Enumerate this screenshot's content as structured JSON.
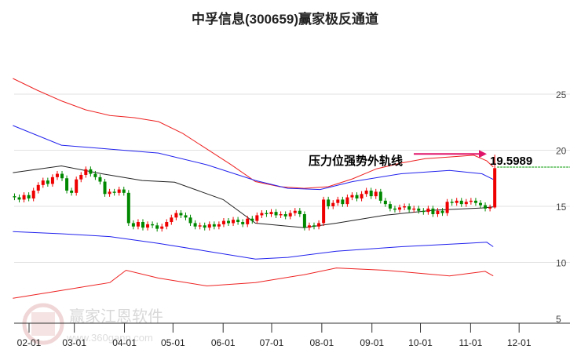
{
  "chart_data": {
    "type": "candlestick",
    "title": "中孚信息(300659)赢家极反通道",
    "xlabel": "",
    "ylabel": "",
    "ylim": [
      4.5,
      27
    ],
    "y_ticks": [
      25,
      20,
      15,
      10,
      5
    ],
    "x_ticks": [
      {
        "label": "02-01",
        "day": 0
      },
      {
        "label": "03-01",
        "day": 28
      },
      {
        "label": "04-01",
        "day": 59
      },
      {
        "label": "05-01",
        "day": 89
      },
      {
        "label": "06-01",
        "day": 120
      },
      {
        "label": "07-01",
        "day": 150
      },
      {
        "label": "08-01",
        "day": 181
      },
      {
        "label": "09-01",
        "day": 212
      },
      {
        "label": "10-01",
        "day": 242
      },
      {
        "label": "11-01",
        "day": 273
      },
      {
        "label": "12-01",
        "day": 303
      }
    ],
    "grid": true,
    "candles": {
      "start_day": -9,
      "step_days": 2.94,
      "first_open": 15.9,
      "closes": [
        15.8,
        15.6,
        16.0,
        15.7,
        16.4,
        16.9,
        17.3,
        17.0,
        17.6,
        17.9,
        17.5,
        16.4,
        16.2,
        17.4,
        17.8,
        18.3,
        17.9,
        17.6,
        17.2,
        16.1,
        16.3,
        16.2,
        16.5,
        16.2,
        13.5,
        13.2,
        13.6,
        13.1,
        13.4,
        13.3,
        13.0,
        13.2,
        13.6,
        14.0,
        14.4,
        14.2,
        14.0,
        13.5,
        13.2,
        13.3,
        13.1,
        13.4,
        13.2,
        13.4,
        13.7,
        13.5,
        13.8,
        13.6,
        13.4,
        13.9,
        13.7,
        14.2,
        14.4,
        14.3,
        14.5,
        14.2,
        14.3,
        14.1,
        14.4,
        14.6,
        14.3,
        13.1,
        13.3,
        13.2,
        13.5,
        15.6,
        15.0,
        15.3,
        15.6,
        15.2,
        15.8,
        16.0,
        15.7,
        16.1,
        16.4,
        15.9,
        16.3,
        15.5,
        15.2,
        14.8,
        14.7,
        14.9,
        15.0,
        14.7,
        14.8,
        14.6,
        14.5,
        14.8,
        14.3,
        14.6,
        14.4,
        15.4,
        15.3,
        15.5,
        15.2,
        15.4,
        15.5,
        15.3,
        15.1,
        14.8,
        14.9
      ],
      "last_candle": {
        "open": 14.9,
        "close": 18.4,
        "high": 19.6,
        "low": 14.8
      }
    },
    "series": [
      {
        "name": "upper-outer",
        "color": "#ee2222",
        "points": [
          [
            -10,
            26.4
          ],
          [
            5,
            25.35
          ],
          [
            20,
            24.4
          ],
          [
            35,
            23.6
          ],
          [
            50,
            23.1
          ],
          [
            65,
            22.9
          ],
          [
            80,
            22.55
          ],
          [
            95,
            21.5
          ],
          [
            110,
            20.1
          ],
          [
            125,
            18.7
          ],
          [
            140,
            17.2
          ],
          [
            155,
            16.75
          ],
          [
            170,
            16.6
          ],
          [
            185,
            16.75
          ],
          [
            200,
            17.45
          ],
          [
            215,
            18.35
          ],
          [
            230,
            18.85
          ],
          [
            245,
            19.25
          ],
          [
            260,
            19.4
          ],
          [
            275,
            19.55
          ],
          [
            283,
            19.05
          ],
          [
            287,
            18.5
          ]
        ]
      },
      {
        "name": "upper-inner",
        "color": "#2222ee",
        "points": [
          [
            -10,
            22.2
          ],
          [
            20,
            20.45
          ],
          [
            50,
            20.1
          ],
          [
            80,
            19.75
          ],
          [
            110,
            18.7
          ],
          [
            140,
            17.3
          ],
          [
            160,
            16.6
          ],
          [
            180,
            16.5
          ],
          [
            200,
            17.2
          ],
          [
            230,
            17.9
          ],
          [
            260,
            18.2
          ],
          [
            280,
            17.9
          ],
          [
            287,
            17.4
          ]
        ]
      },
      {
        "name": "middle",
        "color": "#222222",
        "points": [
          [
            -10,
            18.0
          ],
          [
            20,
            18.6
          ],
          [
            45,
            17.9
          ],
          [
            70,
            17.3
          ],
          [
            90,
            17.15
          ],
          [
            120,
            15.6
          ],
          [
            140,
            13.5
          ],
          [
            170,
            13.1
          ],
          [
            190,
            13.5
          ],
          [
            220,
            14.2
          ],
          [
            250,
            14.65
          ],
          [
            280,
            14.85
          ],
          [
            287,
            14.95
          ]
        ]
      },
      {
        "name": "lower-inner",
        "color": "#2222ee",
        "points": [
          [
            -10,
            12.75
          ],
          [
            20,
            12.55
          ],
          [
            50,
            12.3
          ],
          [
            80,
            11.7
          ],
          [
            110,
            11.0
          ],
          [
            140,
            10.3
          ],
          [
            160,
            10.45
          ],
          [
            190,
            11.0
          ],
          [
            230,
            11.4
          ],
          [
            270,
            11.7
          ],
          [
            283,
            11.8
          ],
          [
            287,
            11.4
          ]
        ]
      },
      {
        "name": "lower-outer",
        "color": "#ee2222",
        "points": [
          [
            -10,
            6.8
          ],
          [
            20,
            7.5
          ],
          [
            50,
            8.2
          ],
          [
            60,
            9.3
          ],
          [
            80,
            8.6
          ],
          [
            110,
            7.9
          ],
          [
            140,
            8.2
          ],
          [
            170,
            8.9
          ],
          [
            190,
            9.5
          ],
          [
            220,
            9.3
          ],
          [
            260,
            8.8
          ],
          [
            282,
            9.2
          ],
          [
            287,
            8.8
          ]
        ]
      }
    ],
    "reference_line": {
      "value": 18.5,
      "color": "#009900"
    },
    "annotation": {
      "text": "压力位强势外轨线",
      "value_label": "19.5989",
      "value": 19.5989
    }
  },
  "watermark": {
    "brand": "赢家江恩软件",
    "url": "www.360gann.com",
    "seal": "江赢恩家"
  },
  "colors": {
    "up": "#ee0000",
    "down": "#008800",
    "arrow": "#e0156a"
  }
}
